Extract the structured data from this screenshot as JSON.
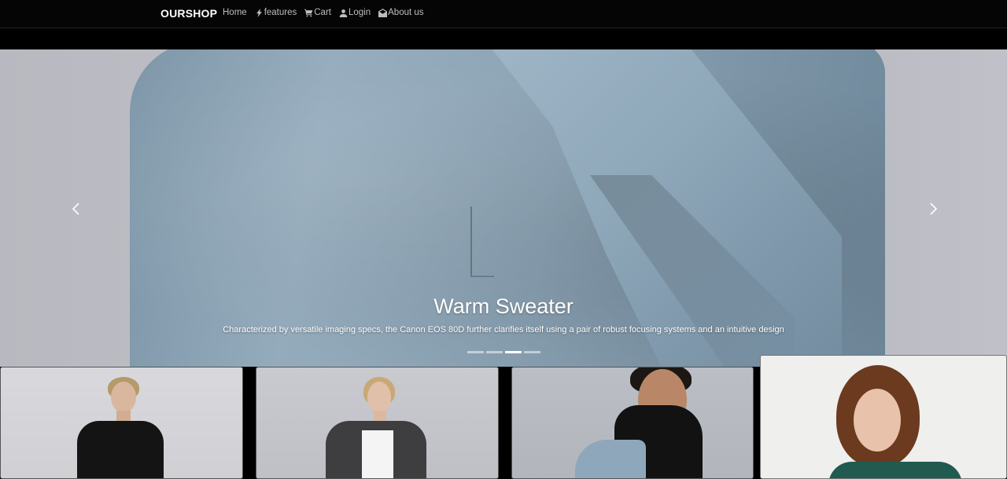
{
  "navbar": {
    "brand": "OURSHOP",
    "links": [
      {
        "label": "Home",
        "icon": "none"
      },
      {
        "label": "features",
        "icon": "bolt-icon"
      },
      {
        "label": "Cart",
        "icon": "cart-icon"
      },
      {
        "label": "Login",
        "icon": "user-icon"
      },
      {
        "label": "About us",
        "icon": "envelope-open-icon"
      }
    ]
  },
  "carousel": {
    "title": "Warm Sweater",
    "text": "Characterized by versatile imaging specs, the Canon EOS 80D further clarifies itself using a pair of robust focusing systems and an intuitive design",
    "slide_count": 4,
    "active_slide": 3
  },
  "products": [
    {
      "image": "model-black-tshirt"
    },
    {
      "image": "model-grey-blazer"
    },
    {
      "image": "model-blue-coat-turtleneck"
    },
    {
      "image": "model-curly-hair-green-top"
    }
  ],
  "colors": {
    "navbar_bg": "#050505",
    "nav_link": "#bdbdbd",
    "coat_blue": "#8aa2b4"
  }
}
